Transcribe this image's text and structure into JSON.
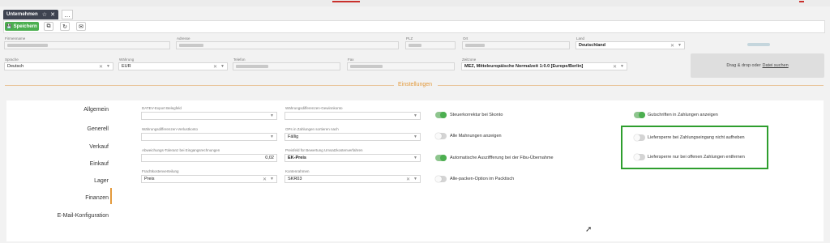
{
  "tab": {
    "title": "Unternehmen",
    "star_icon": "☆",
    "close_icon": "✕",
    "add_icon": "…"
  },
  "toolbar": {
    "save_label": "Speichern",
    "save_icon": "💾",
    "copy_icon": "⧉",
    "refresh_icon": "↻",
    "mail_icon": "✉"
  },
  "company": {
    "name_label": "Firmenname",
    "address_label": "Adresse",
    "zip_label": "PLZ",
    "city_label": "Ort",
    "country_label": "Land",
    "country_value": "Deutschland",
    "language_label": "Sprache",
    "language_value": "Deutsch",
    "currency_label": "Währung",
    "currency_value": "EUR",
    "phone_label": "Telefon",
    "fax_label": "Fax",
    "timezone_label": "Zeitzone",
    "timezone_value": "MEZ, Mitteleuropäische Normalzeit 1:0.0 [Europe/Berlin]"
  },
  "dropzone": {
    "text": "Drag & drop oder",
    "link": "Datei suchen"
  },
  "section_title": "Einstellungen",
  "nav": [
    "Allgemein",
    "Generell",
    "Verkauf",
    "Einkauf",
    "Lager",
    "Finanzen",
    "E-Mail-Konfiguration"
  ],
  "nav_active": "Finanzen",
  "fields": {
    "datev_label": "DATEV-Export Belegfeld",
    "wdiff_gain_label": "Währungsdifferenzen-Gewinnkonto",
    "wdiff_loss_label": "Währungsdifferenzen-Verlustkonto",
    "ops_label": "OPs in Zahlungen sortieren nach",
    "ops_value": "Fällig",
    "tolerance_label": "Abweichungs-Toleranz bei Eingangsrechnungen",
    "tolerance_value": "0,02",
    "price_field_label": "Preisfeld für Bewertung Umsatzkostenverfahren",
    "price_field_value": "EK-Preis",
    "freight_label": "Frachtkostenverteilung",
    "freight_value": "Preis",
    "chart_label": "Kontenrahmen",
    "chart_value": "SKR03"
  },
  "toggles": {
    "tax_correction": {
      "label": "Steuerkorrektur bei Skonto",
      "on": true
    },
    "all_dunning": {
      "label": "Alle Mahnungen anzeigen",
      "on": false
    },
    "auto_fibu": {
      "label": "Automatische Ausziffferung bei der Fibu-Übernahme",
      "on": true
    },
    "pack_all": {
      "label": "Alle-packen-Option im Packtisch",
      "on": false
    },
    "credit_notes": {
      "label": "Gutschriften in Zahlungen anzeigen",
      "on": true
    },
    "delivery_block_receipt": {
      "label": "Liefersperre bei Zahlungseingang nicht aufheben",
      "on": false
    },
    "delivery_block_open": {
      "label": "Liefersperre nur bei offenen Zahlungen entfernen",
      "on": false
    }
  }
}
